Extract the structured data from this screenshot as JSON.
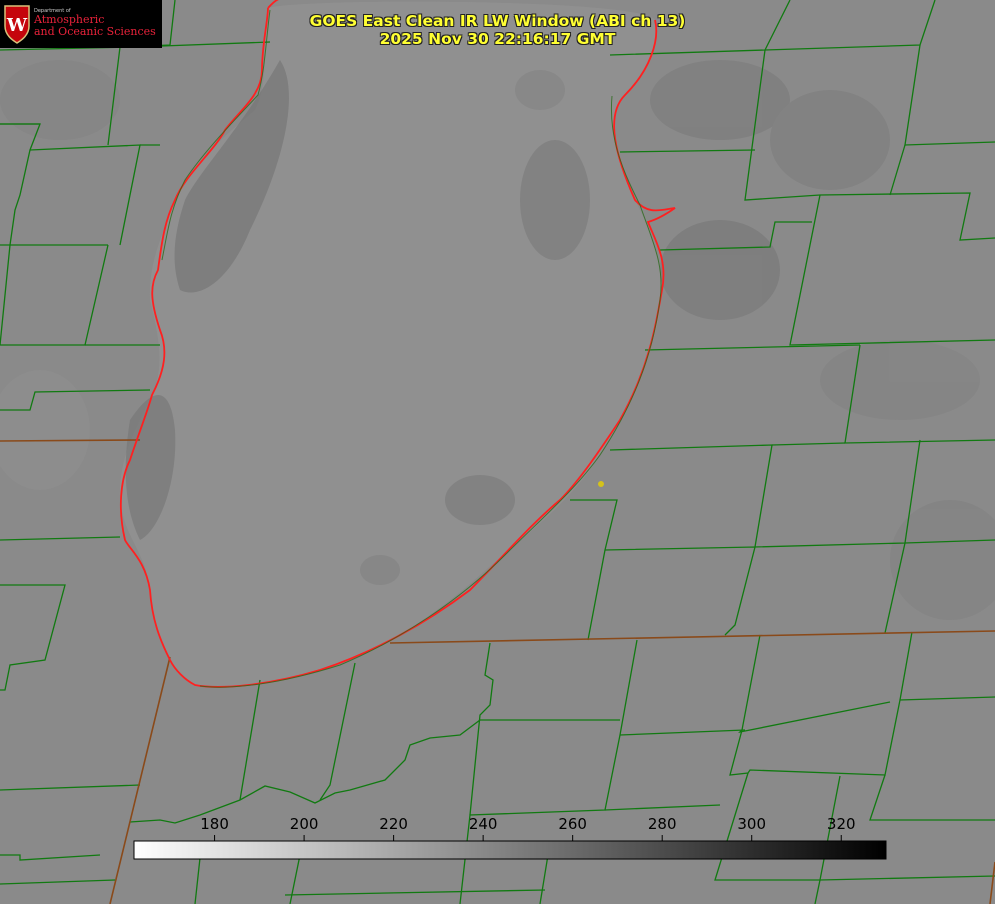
{
  "title": {
    "line1": "GOES East Clean IR LW Window (ABI ch 13)",
    "line2": "2025 Nov 30 22:16:17 GMT"
  },
  "logo": {
    "department": "Department of",
    "line1": "Atmospheric",
    "line2": "and Oceanic Sciences",
    "shield_letter": "W"
  },
  "colorbar": {
    "ticks": [
      "180",
      "200",
      "220",
      "240",
      "260",
      "280",
      "300",
      "320"
    ],
    "min_value": 162,
    "max_value": 330,
    "colormap": "white (cold) to black (warm), grayscale"
  },
  "colors": {
    "background_gray": "#8a8a8a",
    "county_lines": "#117a11",
    "state_lines": "#8a4a1a",
    "lake_outline": "#ff2020",
    "title_text": "#ffff33",
    "station_marker": "#d4c21a"
  }
}
